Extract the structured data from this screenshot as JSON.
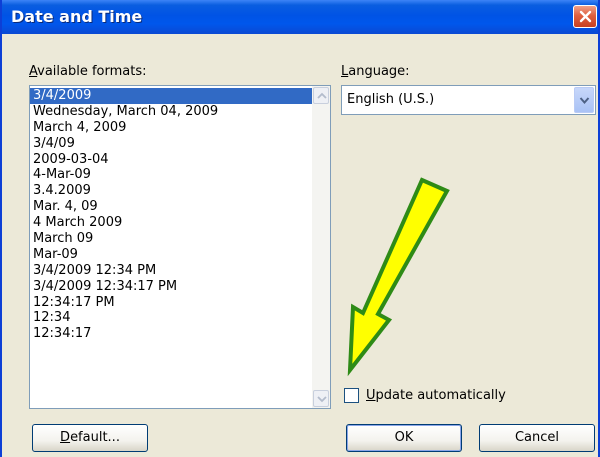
{
  "window": {
    "title": "Date and Time"
  },
  "formats": {
    "label_accel": "A",
    "label_rest": "vailable formats:",
    "items": [
      "3/4/2009",
      "Wednesday, March 04, 2009",
      "March 4, 2009",
      "3/4/09",
      "2009-03-04",
      "4-Mar-09",
      "3.4.2009",
      "Mar. 4, 09",
      "4 March 2009",
      "March 09",
      "Mar-09",
      "3/4/2009 12:34 PM",
      "3/4/2009 12:34:17 PM",
      "12:34:17 PM",
      "12:34",
      "12:34:17"
    ],
    "selected_index": 0
  },
  "language": {
    "label_accel": "L",
    "label_rest": "anguage:",
    "value": "English (U.S.)"
  },
  "update": {
    "label_accel": "U",
    "label_rest": "pdate automatically",
    "checked": false
  },
  "buttons": {
    "default_accel": "D",
    "default_rest": "efault...",
    "ok": "OK",
    "cancel": "Cancel"
  },
  "colors": {
    "titlebar": "#0053e5",
    "selection": "#316ac5",
    "dialog_bg": "#ece9d8",
    "arrow_fill": "#ffff00",
    "arrow_stroke": "#2e8b16"
  },
  "icons": {
    "close": "close-icon",
    "scroll_up": "chevron-up-icon",
    "scroll_down": "chevron-down-icon",
    "combo": "chevron-down-icon",
    "annotation": "arrow-icon"
  }
}
